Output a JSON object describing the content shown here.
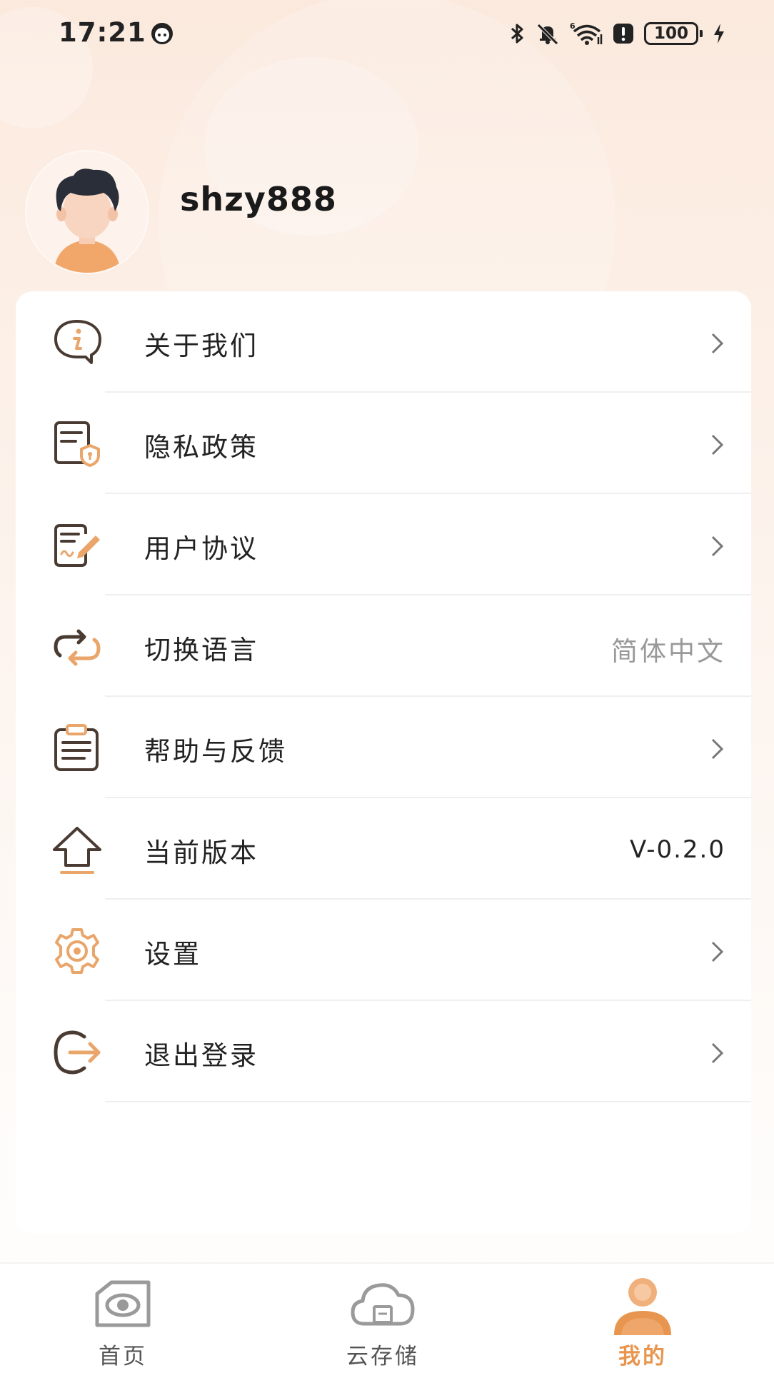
{
  "status_bar": {
    "time": "17:21",
    "battery": "100",
    "icons": [
      "face-icon",
      "bluetooth-icon",
      "mute-icon",
      "wifi-icon",
      "alert-icon",
      "battery-icon",
      "charging-icon"
    ]
  },
  "profile": {
    "username": "shzy888",
    "avatar_icon": "avatar-icon"
  },
  "menu": {
    "items": [
      {
        "icon": "info-icon",
        "label": "关于我们"
      },
      {
        "icon": "privacy-policy-icon",
        "label": "隐私政策"
      },
      {
        "icon": "user-agreement-icon",
        "label": "用户协议"
      },
      {
        "icon": "switch-language-icon",
        "label": "切换语言",
        "value": "简体中文"
      },
      {
        "icon": "help-feedback-icon",
        "label": "帮助与反馈"
      },
      {
        "icon": "upgrade-icon",
        "label": "当前版本",
        "value": "V-0.2.0"
      },
      {
        "icon": "settings-icon",
        "label": "设置"
      },
      {
        "icon": "logout-icon",
        "label": "退出登录"
      }
    ]
  },
  "bottom_nav": {
    "tabs": [
      {
        "icon": "camera-home-icon",
        "label": "首页",
        "active": false
      },
      {
        "icon": "cloud-storage-icon",
        "label": "云存储",
        "active": false
      },
      {
        "icon": "profile-icon",
        "label": "我的",
        "active": true
      }
    ]
  },
  "colors": {
    "accent": "#e8964f",
    "icon_dark": "#4a3b32",
    "icon_light": "#e9a56a",
    "inactive_nav": "#9a9a9a",
    "background_top": "#fbe9dd"
  }
}
